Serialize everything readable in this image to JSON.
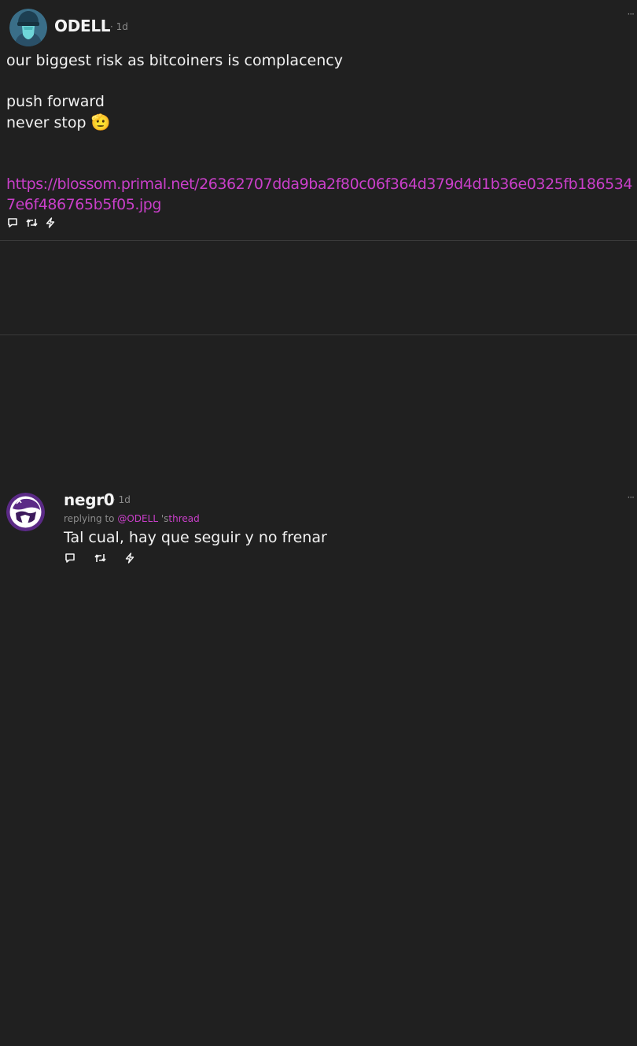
{
  "colors": {
    "background": "#202020",
    "text": "#f2f2f2",
    "muted": "#8c8c8c",
    "accent": "#c93fc9",
    "divider": "#3a3a3a"
  },
  "posts": [
    {
      "author": "ODELL",
      "timestamp": "· 1d",
      "more_icon": "ellipsis-icon",
      "avatar_icon": "hooded-figure-avatar",
      "body_lines": [
        "our biggest risk as bitcoiners is complacency",
        "",
        "push forward",
        "never stop"
      ],
      "emoji": "🫡",
      "link": "https://blossom.primal.net/26362707dda9ba2f80c06f364d379d4d1b36e0325fb1865347e6f486765b5f05.jpg",
      "actions": [
        "reply-icon",
        "repost-icon",
        "zap-icon"
      ]
    },
    {
      "author": "negr0",
      "timestamp": "· 1d",
      "more_icon": "ellipsis-icon",
      "avatar_icon": "purple-mascot-avatar",
      "replying_prefix": "replying to",
      "replying_mention": "@ODELL",
      "replying_suffix": "'s",
      "replying_thread": "thread",
      "body": "Tal cual, hay que seguir y no frenar",
      "actions": [
        "reply-icon",
        "repost-icon",
        "zap-icon"
      ]
    }
  ]
}
